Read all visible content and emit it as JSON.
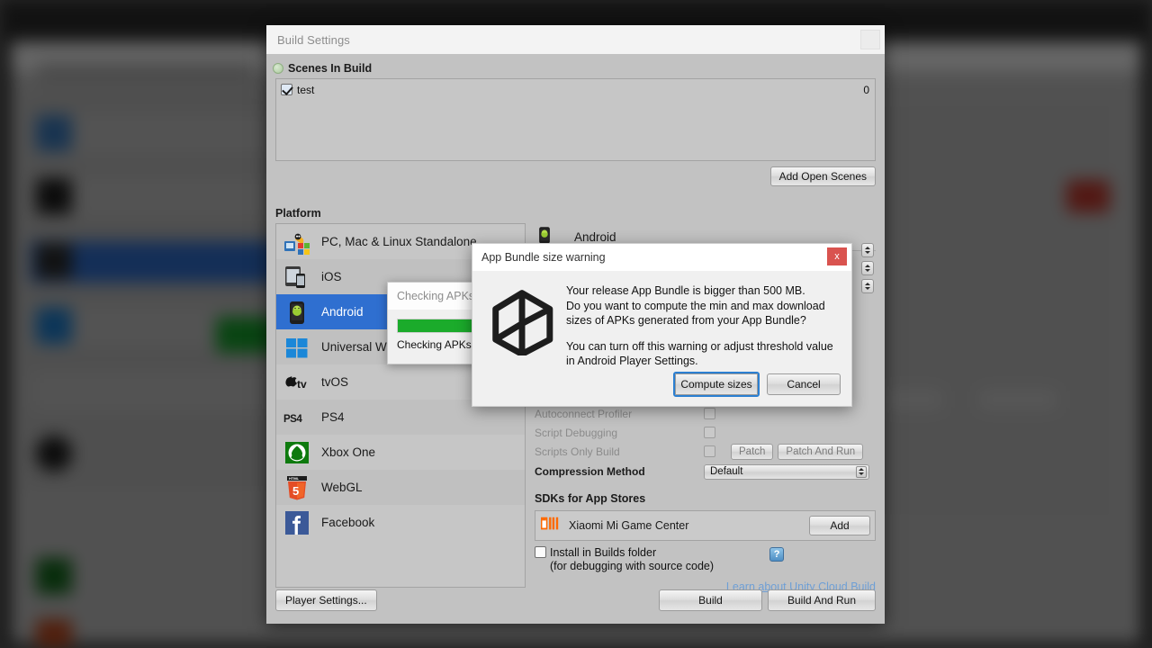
{
  "window": {
    "title": "Build Settings",
    "corner_button": "",
    "scenes_section_title": "Scenes In Build",
    "scenes": [
      {
        "name": "test",
        "index": "0",
        "checked": true
      }
    ],
    "add_open_scenes_label": "Add Open Scenes",
    "platform_section_title": "Platform",
    "platforms": [
      {
        "label": "PC, Mac & Linux Standalone",
        "icon": "pc-standalone-icon",
        "selected": false
      },
      {
        "label": "iOS",
        "icon": "ios-icon",
        "selected": false
      },
      {
        "label": "Android",
        "icon": "android-icon",
        "selected": true
      },
      {
        "label": "Universal Windows Platform",
        "icon": "uwp-icon",
        "selected": false
      },
      {
        "label": "tvOS",
        "icon": "tvos-icon",
        "selected": false
      },
      {
        "label": "PS4",
        "icon": "ps4-icon",
        "selected": false
      },
      {
        "label": "Xbox One",
        "icon": "xbox-one-icon",
        "selected": false
      },
      {
        "label": "WebGL",
        "icon": "webgl-icon",
        "selected": false
      },
      {
        "label": "Facebook",
        "icon": "facebook-icon",
        "selected": false
      }
    ],
    "player_settings_label": "Player Settings..."
  },
  "settings": {
    "active_platform": "Android",
    "options": [
      {
        "label": "Autoconnect Profiler",
        "checked": false,
        "dim": true
      },
      {
        "label": "Script Debugging",
        "checked": false,
        "dim": true
      },
      {
        "label": "Scripts Only Build",
        "checked": false,
        "dim": true
      }
    ],
    "patch_label": "Patch",
    "patch_and_run_label": "Patch And Run",
    "compression_method_label": "Compression Method",
    "compression_method_value": "Default",
    "sdk_section_title": "SDKs for App Stores",
    "sdk_name": "Xiaomi Mi Game Center",
    "sdk_add_label": "Add",
    "install_in_builds_label": "Install in Builds folder",
    "install_in_builds_sub": "(for debugging with source code)",
    "install_in_builds_checked": false,
    "help_icon_glyph": "?",
    "cloud_build_link": "Learn about Unity Cloud Build",
    "build_label": "Build",
    "build_and_run_label": "Build And Run"
  },
  "apk_dialog": {
    "title": "Checking APKs",
    "status": "Checking APKs s",
    "progress_percent": 100,
    "progress_color": "#1bab2b"
  },
  "warning_dialog": {
    "title": "App Bundle size warning",
    "close_glyph": "x",
    "logo": "unity-logo",
    "line1": "Your release App Bundle is bigger than 500 MB.",
    "line2": "Do you want to compute the min and max download",
    "line3": "sizes of APKs generated from your App Bundle?",
    "line4": "You can turn off this warning or adjust threshold value",
    "line5": "in Android Player Settings.",
    "primary_button": "Compute sizes",
    "secondary_button": "Cancel",
    "accent_color": "#2b7fd1",
    "close_color": "#d9534f"
  }
}
